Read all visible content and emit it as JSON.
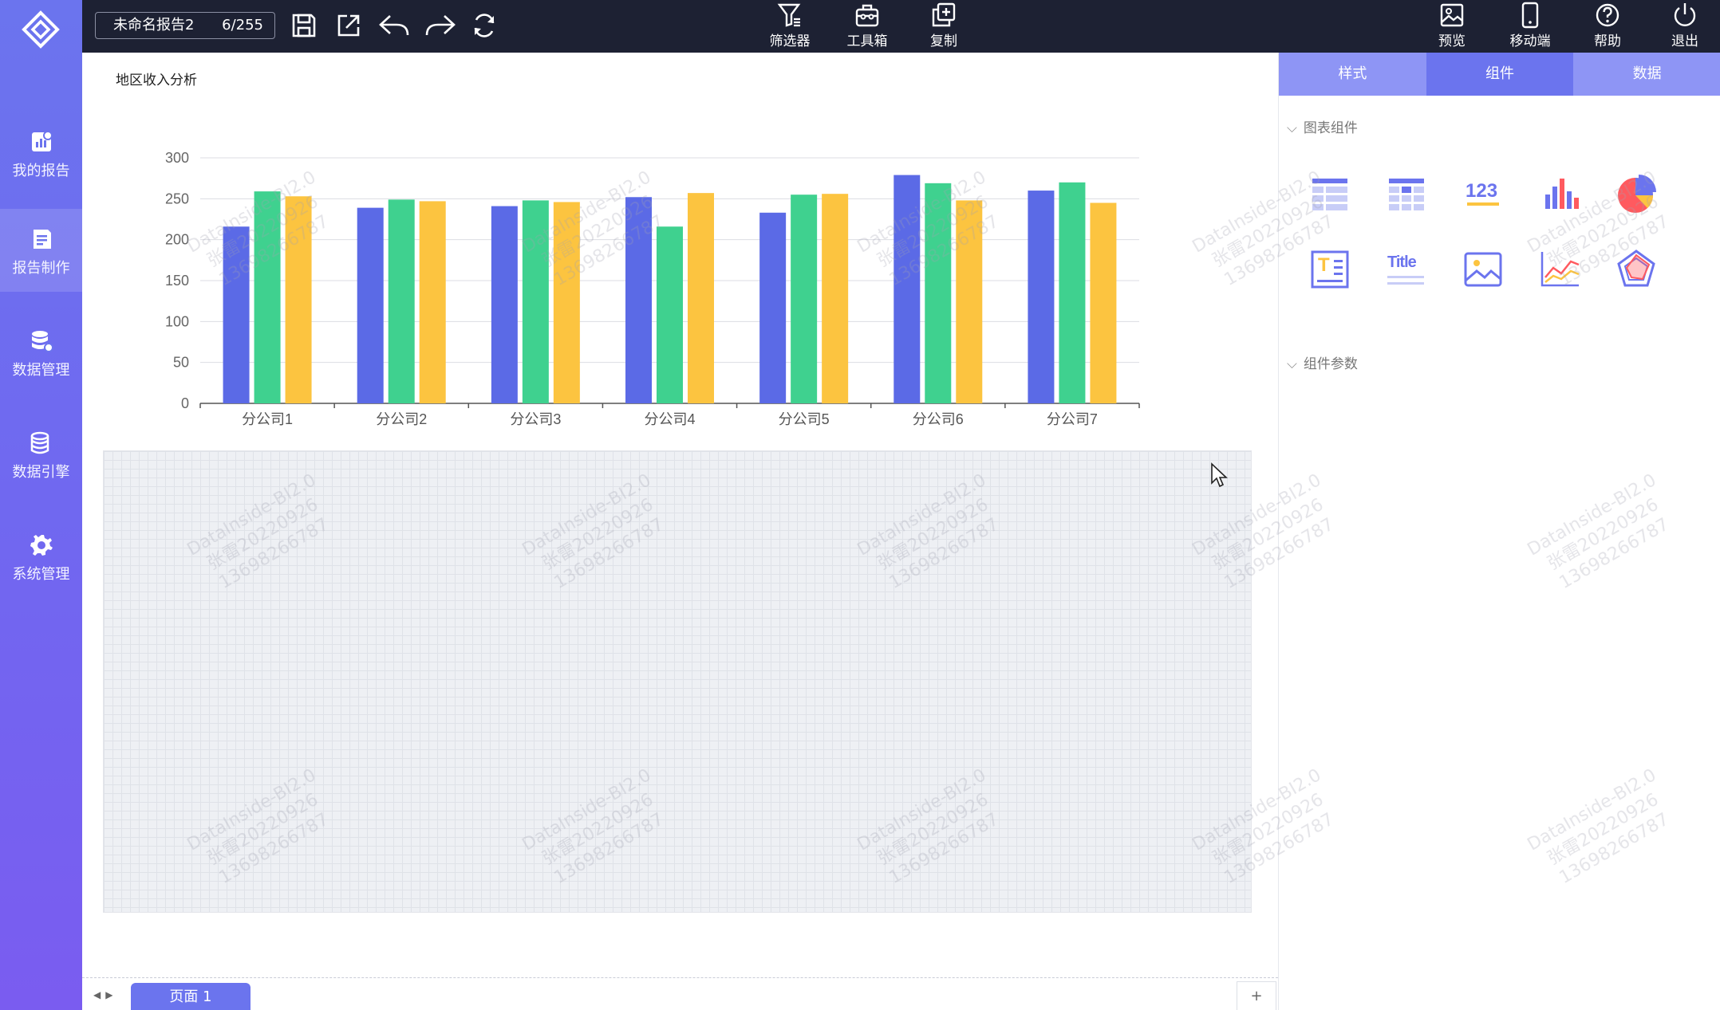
{
  "sidebar": {
    "items": [
      {
        "label": "我的报告",
        "icon": "report-chart-icon"
      },
      {
        "label": "报告制作",
        "icon": "report-edit-icon"
      },
      {
        "label": "数据管理",
        "icon": "database-icon"
      },
      {
        "label": "数据引擎",
        "icon": "engine-icon"
      },
      {
        "label": "系统管理",
        "icon": "gear-icon"
      }
    ],
    "active_index": 1
  },
  "topbar": {
    "report_name": "未命名报告2",
    "char_count": "6/255",
    "center_buttons": [
      {
        "label": "筛选器",
        "icon": "filter-icon"
      },
      {
        "label": "工具箱",
        "icon": "toolbox-icon"
      },
      {
        "label": "复制",
        "icon": "copy-icon"
      }
    ],
    "right_buttons": [
      {
        "label": "预览",
        "icon": "preview-icon"
      },
      {
        "label": "移动端",
        "icon": "mobile-icon"
      },
      {
        "label": "帮助",
        "icon": "help-icon"
      },
      {
        "label": "退出",
        "icon": "power-icon"
      }
    ]
  },
  "chart_data": {
    "type": "bar",
    "title": "地区收入分析",
    "categories": [
      "分公司1",
      "分公司2",
      "分公司3",
      "分公司4",
      "分公司5",
      "分公司6",
      "分公司7"
    ],
    "series": [
      {
        "color": "#5b6ae6",
        "values": [
          216,
          239,
          241,
          252,
          233,
          279,
          260
        ]
      },
      {
        "color": "#3fd18f",
        "values": [
          259,
          249,
          248,
          216,
          255,
          269,
          270
        ]
      },
      {
        "color": "#fcc440",
        "values": [
          253,
          247,
          246,
          257,
          256,
          248,
          245
        ]
      }
    ],
    "ylim": [
      0,
      300
    ],
    "yticks": [
      0,
      50,
      100,
      150,
      200,
      250,
      300
    ],
    "grid": true
  },
  "pages": {
    "current": "页面 1",
    "add_label": "+"
  },
  "right_panel": {
    "tabs": [
      "样式",
      "组件",
      "数据"
    ],
    "active_tab": 1,
    "chart_section": "图表组件",
    "params_section": "组件参数",
    "components": [
      {
        "icon": "table-icon"
      },
      {
        "icon": "cross-table-icon"
      },
      {
        "icon": "number-kpi-icon",
        "text": "123"
      },
      {
        "icon": "bar-chart-icon"
      },
      {
        "icon": "pie-chart-icon"
      },
      {
        "icon": "text-box-icon",
        "text": "T"
      },
      {
        "icon": "title-icon",
        "text": "Title"
      },
      {
        "icon": "image-icon"
      },
      {
        "icon": "line-chart-icon"
      },
      {
        "icon": "radar-chart-icon"
      }
    ]
  },
  "watermark": {
    "lines": [
      "DataInside-BI2.0",
      "张雷20220926",
      "13698266787"
    ]
  }
}
